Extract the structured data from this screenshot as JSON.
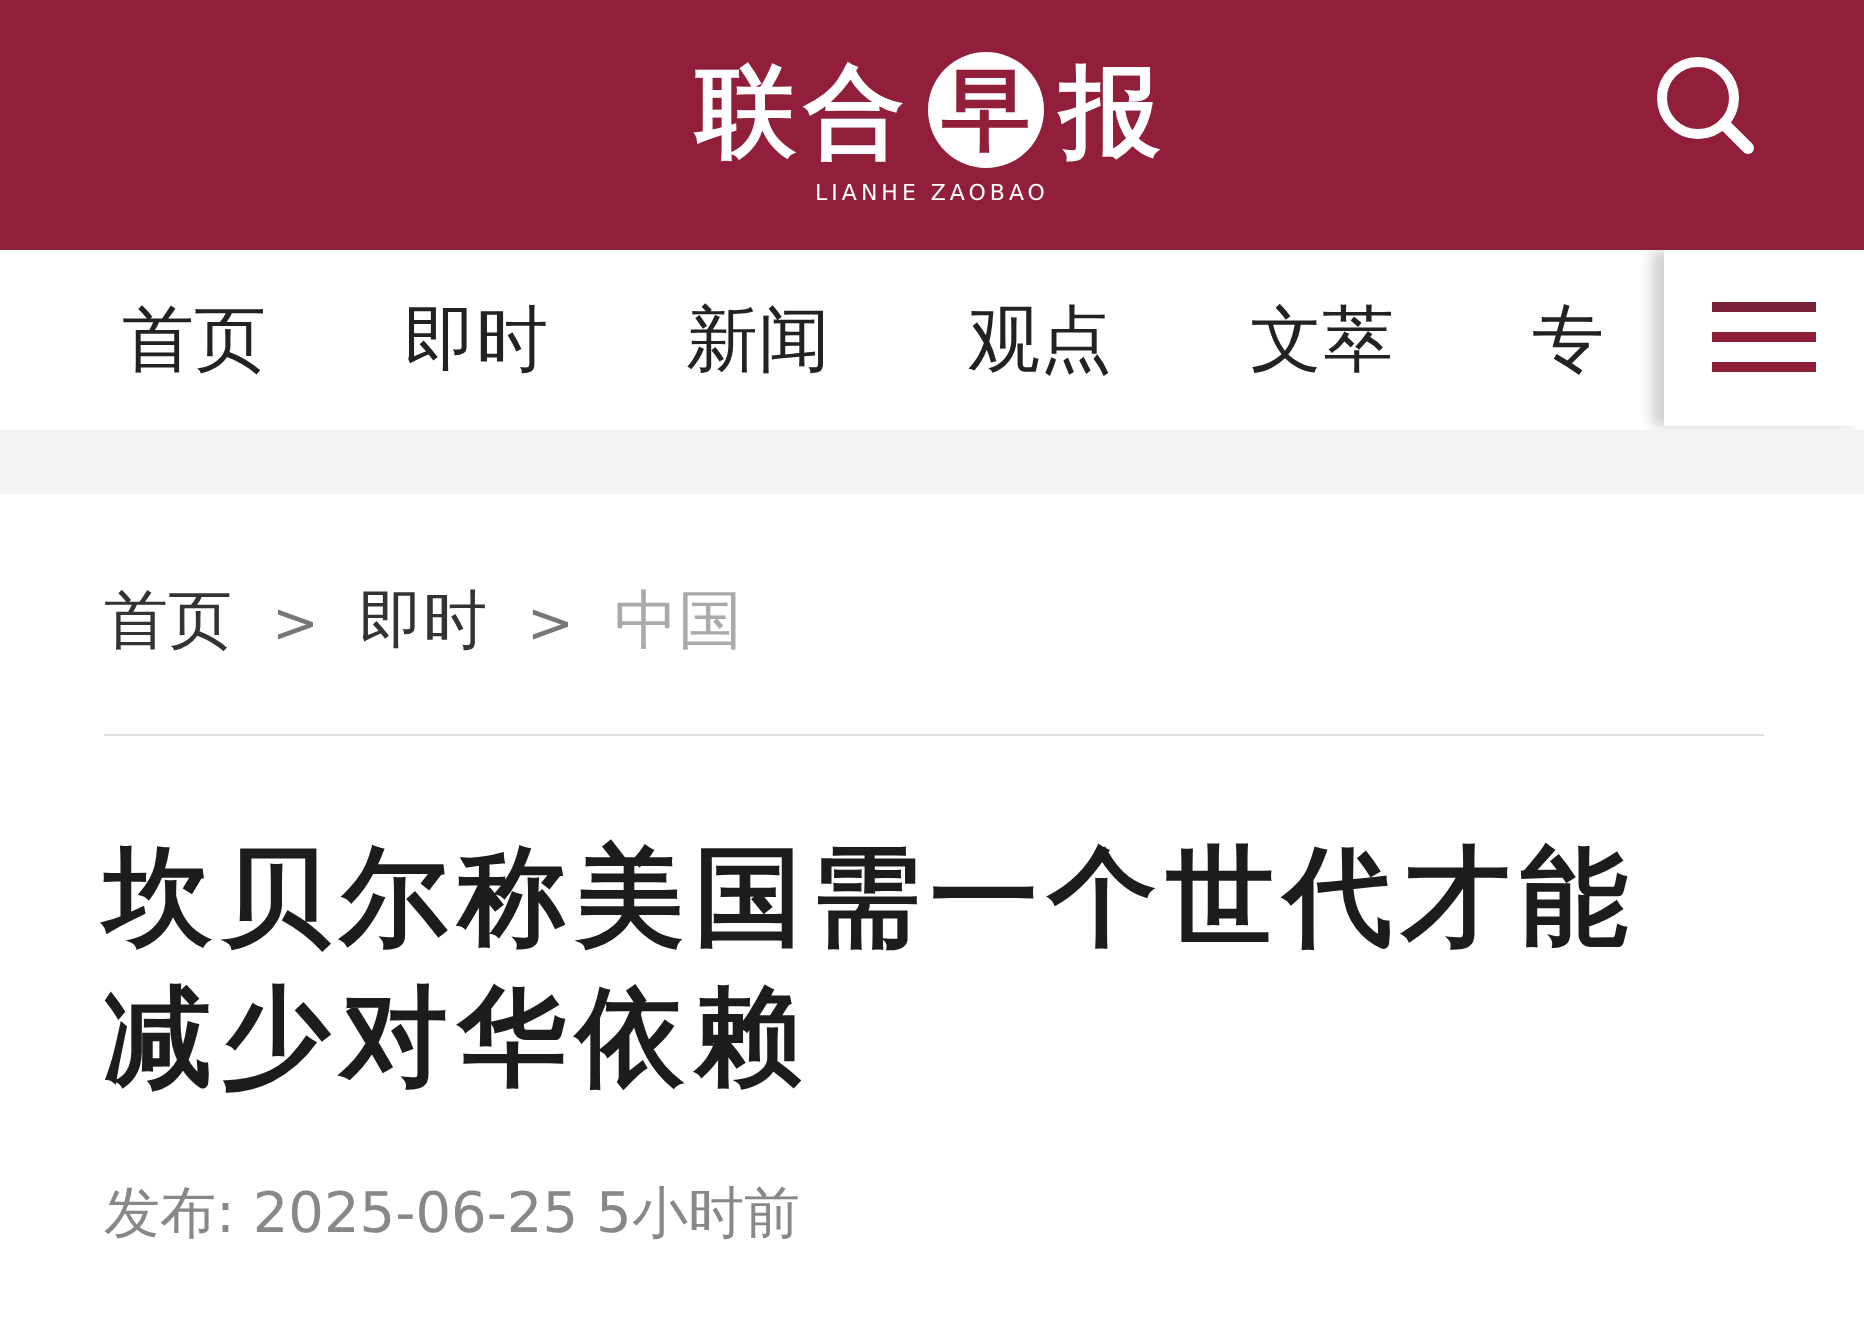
{
  "header": {
    "logo": {
      "text_before": "联合",
      "emblem": "早",
      "text_after": "报",
      "subtitle": "LIANHE ZAOBAO"
    }
  },
  "nav": {
    "tabs": [
      {
        "label": "首页"
      },
      {
        "label": "即时"
      },
      {
        "label": "新闻"
      },
      {
        "label": "观点"
      },
      {
        "label": "文萃"
      },
      {
        "label": "专"
      }
    ]
  },
  "breadcrumb": [
    {
      "label": "首页",
      "current": false
    },
    {
      "label": "即时",
      "current": false
    },
    {
      "label": "中国",
      "current": true
    }
  ],
  "breadcrumb_separator": ">",
  "article": {
    "title": "坎贝尔称美国需一个世代才能减少对华依赖",
    "published": "发布: 2025-06-25 5小时前"
  }
}
